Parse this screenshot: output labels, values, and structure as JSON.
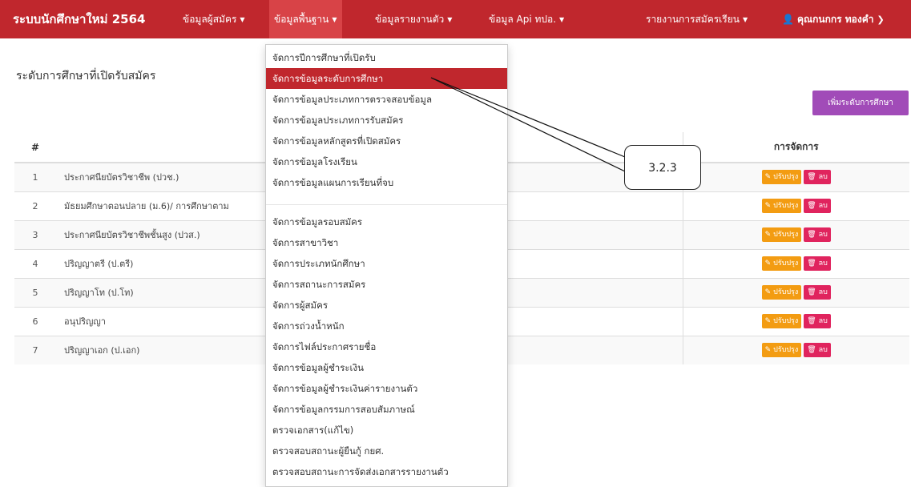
{
  "navbar": {
    "brand": "ระบบนักศึกษาใหม่ 2564",
    "menus": [
      "ข้อมูลผู้สมัคร",
      "ข้อมูลพื้นฐาน",
      "ข้อมูลรายงานตัว",
      "ข้อมูล Api ทปอ."
    ],
    "report_menu": "รายงานการสมัครเรียน",
    "user": "คุณกนกกร ทองคำ"
  },
  "page": {
    "title": "ระดับการศึกษาที่เปิดรับสมัคร",
    "add_button": "เพิ่มระดับการศึกษา"
  },
  "table": {
    "headers": {
      "number": "#",
      "name": "",
      "manage": "การจัดการ"
    },
    "rows": [
      {
        "no": "1",
        "name": "ประกาศนียบัตรวิชาชีพ (ปวช.)"
      },
      {
        "no": "2",
        "name": "มัธยมศึกษาตอนปลาย (ม.6)/ การศึกษาตาม"
      },
      {
        "no": "3",
        "name": "ประกาศนียบัตรวิชาชีพชั้นสูง (ปวส.)"
      },
      {
        "no": "4",
        "name": "ปริญญาตรี (ป.ตรี)"
      },
      {
        "no": "5",
        "name": "ปริญญาโท (ป.โท)"
      },
      {
        "no": "6",
        "name": "อนุปริญญา"
      },
      {
        "no": "7",
        "name": "ปริญญาเอก (ป.เอก)"
      }
    ],
    "edit_label": "ปรับปรุง",
    "delete_label": "ลบ"
  },
  "dropdown": {
    "group1": [
      "จัดการปีการศึกษาที่เปิดรับ",
      "จัดการข้อมูลระดับการศึกษา",
      "จัดการข้อมูลประเภทการตรวจสอบข้อมูล",
      "จัดการข้อมูลประเภทการรับสมัคร",
      "จัดการข้อมูลหลักสูตรที่เปิดสมัคร",
      "จัดการข้อมูลโรงเรียน",
      "จัดการข้อมูลแผนการเรียนที่จบ"
    ],
    "group2": [
      "จัดการข้อมูลรอบสมัคร",
      "จัดการสาขาวิชา",
      "จัดการประเภทนักศึกษา",
      "จัดการสถานะการสมัคร",
      "จัดการผู้สมัคร",
      "จัดการถ่วงน้ำหนัก",
      "จัดการไฟล์ประกาศรายชื่อ",
      "จัดการข้อมูลผู้ชำระเงิน",
      "จัดการข้อมูลผู้ชำระเงินค่ารายงานตัว",
      "จัดการข้อมูลกรรมการสอบสัมภาษณ์",
      "ตรวจเอกสาร(แก้ไข)",
      "ตรวจสอบสถานะผู้ยืนกู้ กยศ.",
      "ตรวจสอบสถานะการจัดส่งเอกสารรายงานตัว"
    ]
  },
  "callout": {
    "label": "3.2.3"
  },
  "icons": {
    "caret": "caret-down-icon",
    "user": "user-icon",
    "edit": "pencil-icon",
    "delete": "trash-icon",
    "user_menu": "chevron-down-icon"
  },
  "colors": {
    "navbar": "#c0272d",
    "active_menu": "#d84347",
    "add_button": "#a14bb8",
    "edit_button": "#f39c12",
    "delete_button": "#e0245e"
  }
}
